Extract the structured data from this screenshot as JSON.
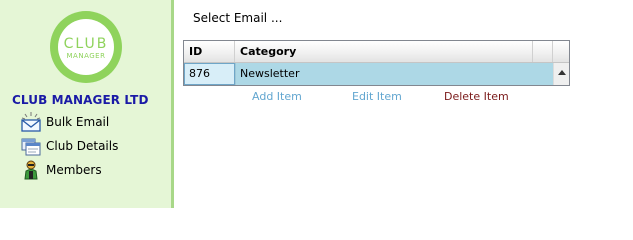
{
  "sidebar": {
    "logo_top": "CLUB",
    "logo_bottom": "MANAGER",
    "company_name": "CLUB MANAGER LTD",
    "items": [
      {
        "label": "Bulk Email",
        "icon": "envelope-icon"
      },
      {
        "label": "Club Details",
        "icon": "window-icon"
      },
      {
        "label": "Members",
        "icon": "person-icon"
      }
    ]
  },
  "main": {
    "title": "Select Email ...",
    "grid": {
      "columns": [
        "ID",
        "Category"
      ],
      "rows": [
        {
          "id": "876",
          "category": "Newsletter"
        }
      ]
    },
    "actions": {
      "add": "Add Item",
      "edit": "Edit Item",
      "delete": "Delete Item"
    }
  },
  "colors": {
    "sidebar_bg": "#e5f6d6",
    "sidebar_border": "#a8d888",
    "company_name": "#1a1aa6",
    "selected_row": "#add8e6",
    "link": "#62a6d0",
    "delete_link": "#7a1a1a"
  }
}
